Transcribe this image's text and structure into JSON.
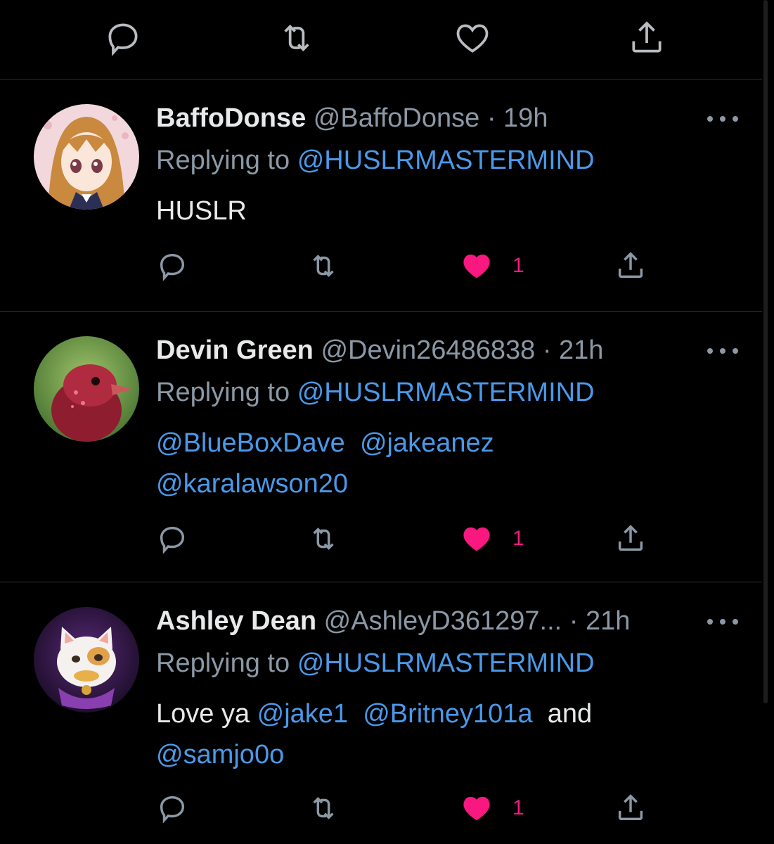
{
  "colors": {
    "background": "#000000",
    "mention": "#4a99e9",
    "like": "#f91880",
    "muted": "#8b98a5",
    "divider": "#2f3336"
  },
  "top_actions": {
    "icons": [
      "reply-icon",
      "retweet-icon",
      "like-icon",
      "share-icon"
    ]
  },
  "tweets": [
    {
      "name": "BaffoDonse",
      "handle": "@BaffoDonse",
      "dot": "·",
      "time": "19h",
      "replying_prefix": "Replying to",
      "replying_to": "@HUSLRMASTERMIND",
      "body_line1": [
        "HUSLR"
      ],
      "like_count": "1",
      "avatar": "anime-girl-avatar"
    },
    {
      "name": "Devin Green",
      "handle": "@Devin26486838",
      "dot": "·",
      "time": "21h",
      "replying_prefix": "Replying to",
      "replying_to": "@HUSLRMASTERMIND",
      "mentions": [
        "@BlueBoxDave",
        "@jakeanez",
        "@karalawson20"
      ],
      "like_count": "1",
      "avatar": "red-bird-avatar"
    },
    {
      "name": "Ashley Dean",
      "handle": "@AshleyD361297...",
      "dot": "·",
      "time": "21h",
      "replying_prefix": "Replying to",
      "replying_to": "@HUSLRMASTERMIND",
      "body_text": "Love ya",
      "mentions": [
        "@jake1",
        "@Britney101a",
        "@samjo0o"
      ],
      "body_and": "and",
      "like_count": "1",
      "avatar": "cat-avatar"
    }
  ]
}
